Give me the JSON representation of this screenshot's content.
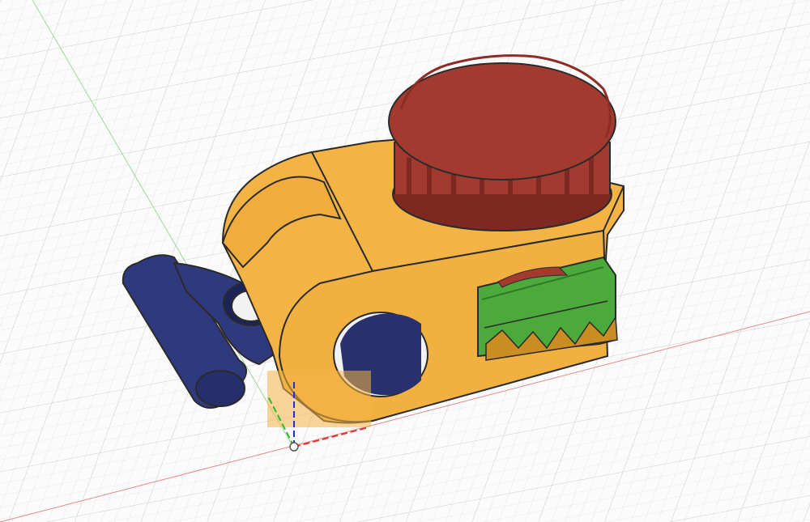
{
  "viewport": {
    "background": "#fbfbfb",
    "grid_minor_color": "#e2e2e2",
    "grid_major_color": "#cdcdcd",
    "x_axis_color": "#e06a6a",
    "y_axis_color": "#7bd27b",
    "z_axis_color": "#3a4fd6"
  },
  "model": {
    "bracket_color": "#f4b445",
    "bracket_shade_color": "#c98d24",
    "knob_color": "#a33a30",
    "knob_shade_color": "#7e2822",
    "lever_color": "#2f3a7e",
    "lever_shade_color": "#1c2457",
    "jaw_color": "#4caa3c",
    "jaw_shade_color": "#2f7a24",
    "edge_color": "#2a2a2a"
  },
  "icons": {
    "origin_point": "origin-point-icon",
    "view_triad": "axis-triad-icon"
  }
}
